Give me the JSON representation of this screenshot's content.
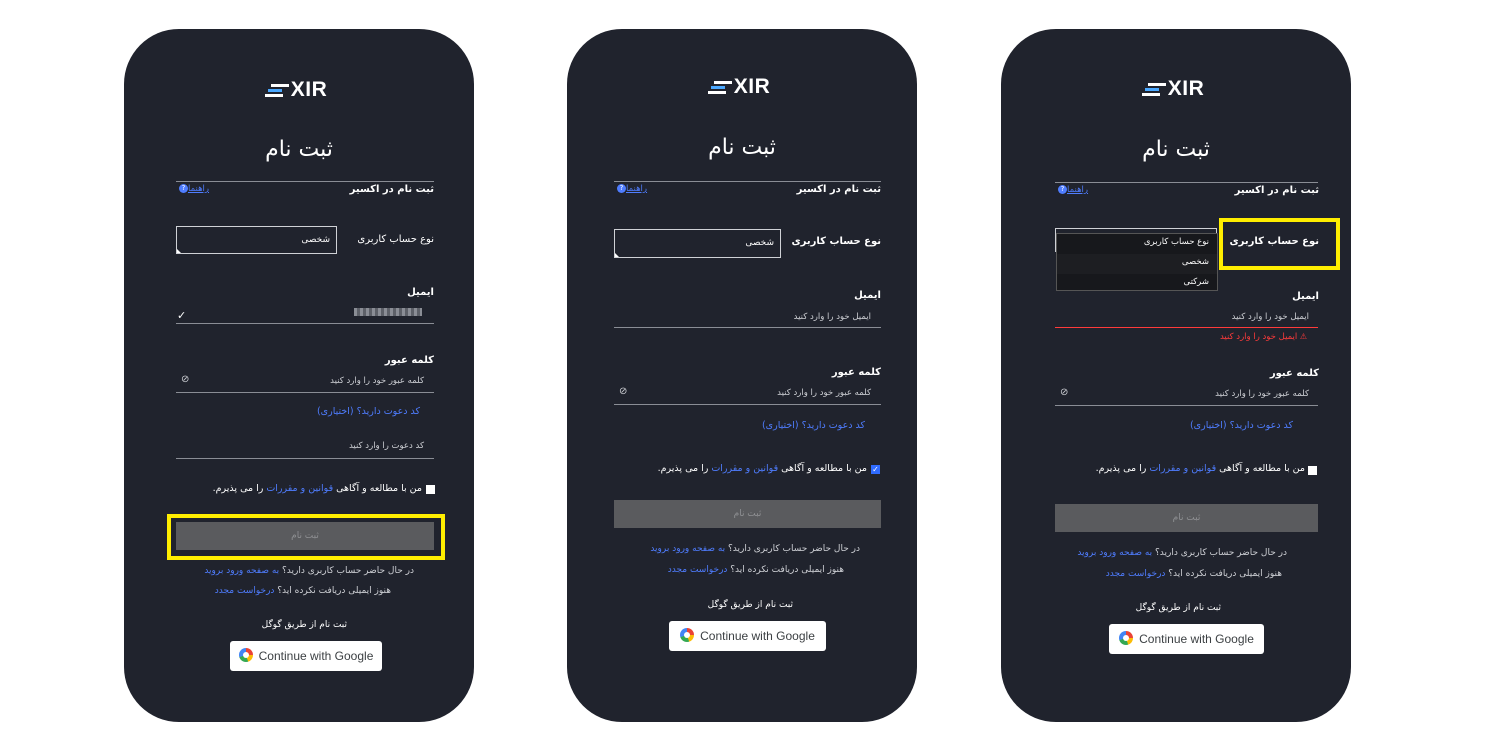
{
  "brand": "XIR",
  "signup_title": "ثبت نام",
  "section_title": "ثبت نام در اکسیر",
  "help_link": "راهنما",
  "account_type_label": "نوع حساب کاربری",
  "account_type_value": "شخصی",
  "account_type_options": [
    "نوع حساب کاربری",
    "شخصی",
    "شرکتی"
  ],
  "email_label": "ایمیل",
  "email_placeholder": "ایمیل خود را وارد کنید",
  "email_error": "ایمیل خود را وارد کنید",
  "password_label": "کلمه عبور",
  "password_placeholder": "کلمه عبور خود را وارد کنید",
  "invite_prompt": "کد دعوت دارید؟ (اختیاری)",
  "invite_placeholder": "کد دعوت را وارد کنید",
  "terms_prefix": "من با مطالعه و آگاهی ",
  "terms_link": "قوانین و مقررات",
  "terms_suffix": " را می پذیرم.",
  "submit_label": "ثبت نام",
  "have_account_text": "در حال حاضر حساب کاربری دارید؟ ",
  "login_link": "به صفحه ورود بروید",
  "no_email_text": "هنوز ایمیلی دریافت نکرده اید؟ ",
  "resend_link": "درخواست مجدد",
  "google_section": "ثبت نام از طریق گوگل",
  "google_button": "Continue with Google",
  "colors": {
    "background": "#20232d",
    "link": "#4f7dff",
    "highlight": "#ffee00",
    "error": "#ff3b3b"
  }
}
